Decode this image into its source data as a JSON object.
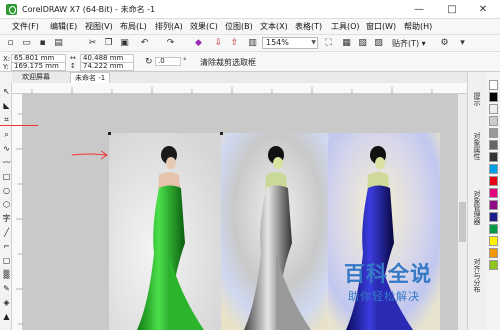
{
  "app": {
    "title": "CorelDRAW X7 (64-Bit) - 未命名 -1"
  },
  "window_controls": {
    "minimize": "—",
    "maximize": "□",
    "close": "✕"
  },
  "menu": [
    "文件(F)",
    "编辑(E)",
    "视图(V)",
    "布局(L)",
    "排列(A)",
    "效果(C)",
    "位图(B)",
    "文本(X)",
    "表格(T)",
    "工具(O)",
    "窗口(W)",
    "帮助(H)"
  ],
  "toolbar": {
    "zoom_value": "154%",
    "snap_label": "贴齐(T) ▾"
  },
  "properties": {
    "x_label": "X:",
    "x_value": "65.801 mm",
    "y_label": "Y:",
    "y_value": "169.175 mm",
    "width_value": "40.488 mm",
    "height_value": "74.222 mm",
    "angle_value": ".0",
    "angle_unit": "°",
    "clear_button": "清除裁剪选取框"
  },
  "tabs": [
    "欢迎屏幕",
    "未命名 -1"
  ],
  "dockers": [
    "提示",
    "对象属性",
    "对象管理器",
    "对齐与分布"
  ],
  "palette": {
    "colors": [
      "#ffffff",
      "#000000",
      "#eeeeee",
      "#cccccc",
      "#999999",
      "#666666",
      "#333333",
      "#00a0e9",
      "#e60012",
      "#e4007f",
      "#920783",
      "#1d2088",
      "#009944",
      "#fff100",
      "#f39800",
      "#8fc31f"
    ]
  },
  "watermark": {
    "logo": "百科全说",
    "sub": "助你轻松解决"
  }
}
